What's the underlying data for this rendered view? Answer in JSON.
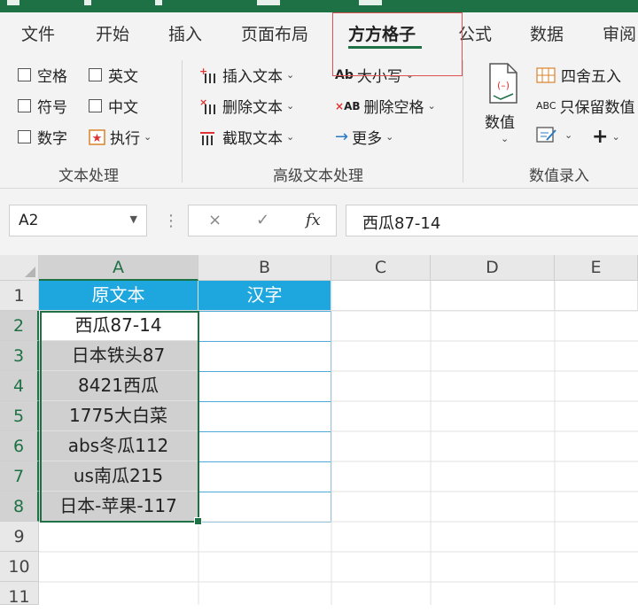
{
  "ribbon_tabs": [
    "文件",
    "开始",
    "插入",
    "页面布局",
    "方方格子",
    "公式",
    "数据",
    "审阅"
  ],
  "text_group": {
    "checkboxes": [
      "空格",
      "英文",
      "符号",
      "中文",
      "数字"
    ],
    "execute_label": "执行",
    "group_label": "文本处理"
  },
  "advanced_group": {
    "insert_text": "插入文本",
    "delete_text": "删除文本",
    "extract_text": "截取文本",
    "case_label": "大小写",
    "delete_space": "删除空格",
    "more_label": "更多",
    "group_label": "高级文本处理"
  },
  "value_group": {
    "value_label": "数值",
    "round_label": "四舍五入",
    "keep_value_label": "只保留数值",
    "group_label": "数值录入"
  },
  "formula_bar": {
    "name_box": "A2",
    "content": "西瓜87-14",
    "cancel_icon": "×",
    "confirm_icon": "✓",
    "fx_label": "fx"
  },
  "sheet": {
    "columns": [
      "A",
      "B",
      "C",
      "D",
      "E"
    ],
    "rows": [
      "1",
      "2",
      "3",
      "4",
      "5",
      "6",
      "7",
      "8",
      "9",
      "10",
      "11"
    ],
    "header_a": "原文本",
    "header_b": "汉字",
    "values_a": [
      "西瓜87-14",
      "日本铁头87",
      "8421西瓜",
      "1775大白菜",
      "abs冬瓜112",
      "us南瓜215",
      "日本-苹果-117"
    ]
  },
  "colors": {
    "excel_green": "#1e7145",
    "header_blue": "#1ea7df",
    "highlight_red": "#e05050",
    "selected_gray": "#d0d0d0"
  }
}
